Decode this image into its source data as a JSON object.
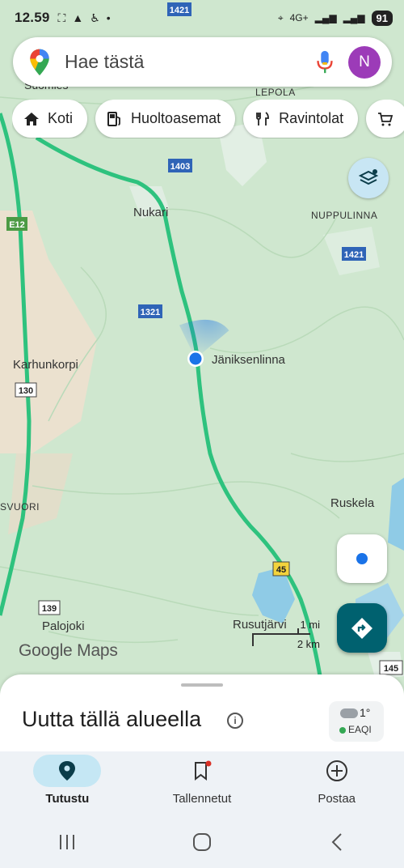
{
  "status_bar": {
    "time": "12.59",
    "network": "4G+",
    "battery": "91"
  },
  "search": {
    "placeholder": "Hae tästä",
    "avatar_letter": "N"
  },
  "chips": [
    {
      "label": "Koti",
      "icon": "home-icon"
    },
    {
      "label": "Huoltoasemat",
      "icon": "gas-station-icon"
    },
    {
      "label": "Ravintolat",
      "icon": "restaurant-icon"
    },
    {
      "label": "",
      "icon": "shopping-cart-icon"
    }
  ],
  "map": {
    "places": [
      "Nukari",
      "Karhunkorpi",
      "Jäniksenlinna",
      "Ruskela",
      "Palojoki",
      "Rusutjärvi",
      "NUPPULINNA",
      "LEPOLA",
      "SVUORI",
      "Suomies"
    ],
    "road_shields": [
      "1421",
      "1403",
      "1421",
      "1321",
      "130",
      "45",
      "139",
      "145",
      "E12"
    ],
    "scale": {
      "mi": "1 mi",
      "km": "2 km"
    },
    "logo": "Google Maps"
  },
  "sheet": {
    "title": "Uutta tällä alueella",
    "weather_temp": "1°",
    "weather_aqi": "EAQI"
  },
  "nav": [
    {
      "label": "Tutustu",
      "icon": "explore-pin-icon",
      "active": true
    },
    {
      "label": "Tallennetut",
      "icon": "bookmark-icon",
      "active": false
    },
    {
      "label": "Postaa",
      "icon": "add-circle-icon",
      "active": false
    }
  ],
  "colors": {
    "road": "#2ec27e",
    "map_bg": "#cfe7cf",
    "accent": "#00616f",
    "avatar": "#9c3bb8"
  }
}
